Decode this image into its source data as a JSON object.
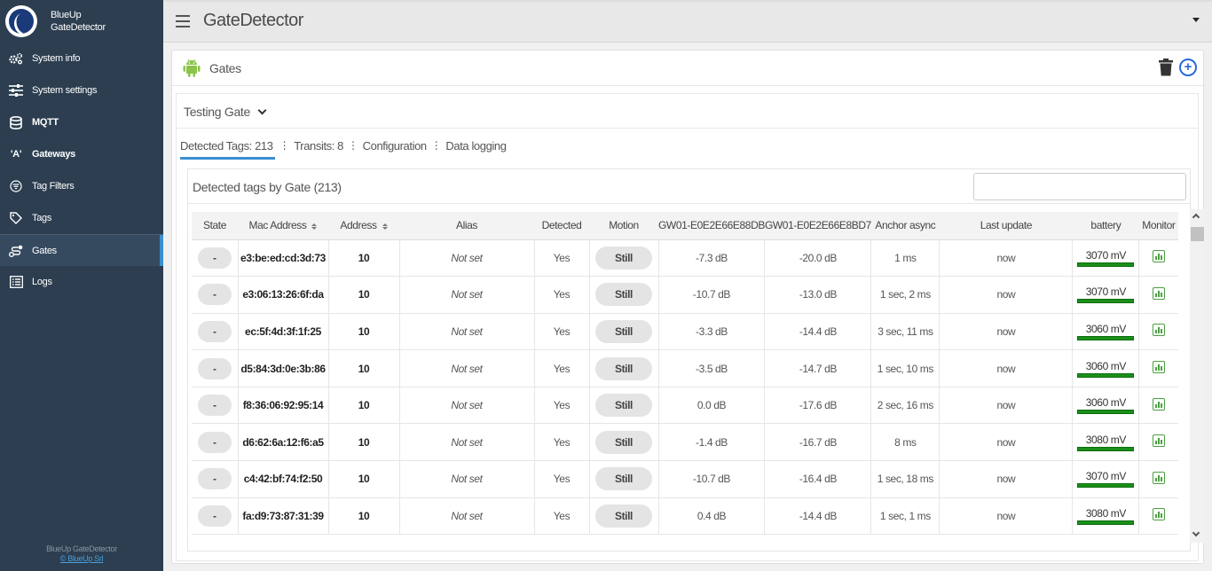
{
  "brand": {
    "line1": "BlueUp",
    "line2": "GateDetector"
  },
  "sidebar": {
    "items": [
      {
        "label": "System info",
        "icon": "cogs-icon"
      },
      {
        "label": "System settings",
        "icon": "sliders-icon"
      },
      {
        "label": "MQTT",
        "icon": "database-icon"
      },
      {
        "label": "Gateways",
        "icon": "antenna-icon"
      },
      {
        "label": "Tag Filters",
        "icon": "filter-icon"
      },
      {
        "label": "Tags",
        "icon": "tag-icon"
      },
      {
        "label": "Gates",
        "icon": "route-icon",
        "active": true
      },
      {
        "label": "Logs",
        "icon": "list-icon"
      }
    ],
    "footer_line1": "BlueUp GateDetector",
    "footer_link": "© BlueUp Srl"
  },
  "header": {
    "title": "GateDetector"
  },
  "card": {
    "title": "Gates"
  },
  "gate_select": {
    "value": "Testing Gate"
  },
  "tabs": [
    {
      "label": "Detected Tags: 213",
      "active": true
    },
    {
      "label": "Transits: 8"
    },
    {
      "label": "Configuration"
    },
    {
      "label": "Data logging"
    }
  ],
  "panel": {
    "title": "Detected tags by Gate (213)",
    "search_placeholder": ""
  },
  "table": {
    "columns": [
      "State",
      "Mac Address",
      "Address",
      "Alias",
      "Detected",
      "Motion",
      "GW01-E0E2E66E88DB",
      "GW01-E0E2E66E8BD7",
      "Anchor async",
      "Last update",
      "battery",
      "Monitor"
    ],
    "rows": [
      {
        "state": "-",
        "mac": "e3:be:ed:cd:3d:73",
        "address": "10",
        "alias": "Not set",
        "detected": "Yes",
        "motion": "Still",
        "gw1": "-7.3 dB",
        "gw2": "-20.0 dB",
        "anchor": "1 ms",
        "last_update": "now",
        "battery": "3070 mV"
      },
      {
        "state": "-",
        "mac": "e3:06:13:26:6f:da",
        "address": "10",
        "alias": "Not set",
        "detected": "Yes",
        "motion": "Still",
        "gw1": "-10.7 dB",
        "gw2": "-13.0 dB",
        "anchor": "1 sec, 2 ms",
        "last_update": "now",
        "battery": "3070 mV"
      },
      {
        "state": "-",
        "mac": "ec:5f:4d:3f:1f:25",
        "address": "10",
        "alias": "Not set",
        "detected": "Yes",
        "motion": "Still",
        "gw1": "-3.3 dB",
        "gw2": "-14.4 dB",
        "anchor": "3 sec, 11 ms",
        "last_update": "now",
        "battery": "3060 mV"
      },
      {
        "state": "-",
        "mac": "d5:84:3d:0e:3b:86",
        "address": "10",
        "alias": "Not set",
        "detected": "Yes",
        "motion": "Still",
        "gw1": "-3.5 dB",
        "gw2": "-14.7 dB",
        "anchor": "1 sec, 10 ms",
        "last_update": "now",
        "battery": "3060 mV"
      },
      {
        "state": "-",
        "mac": "f8:36:06:92:95:14",
        "address": "10",
        "alias": "Not set",
        "detected": "Yes",
        "motion": "Still",
        "gw1": "0.0 dB",
        "gw2": "-17.6 dB",
        "anchor": "2 sec, 16 ms",
        "last_update": "now",
        "battery": "3060 mV"
      },
      {
        "state": "-",
        "mac": "d6:62:6a:12:f6:a5",
        "address": "10",
        "alias": "Not set",
        "detected": "Yes",
        "motion": "Still",
        "gw1": "-1.4 dB",
        "gw2": "-16.7 dB",
        "anchor": "8 ms",
        "last_update": "now",
        "battery": "3080 mV"
      },
      {
        "state": "-",
        "mac": "c4:42:bf:74:f2:50",
        "address": "10",
        "alias": "Not set",
        "detected": "Yes",
        "motion": "Still",
        "gw1": "-10.7 dB",
        "gw2": "-16.4 dB",
        "anchor": "1 sec, 18 ms",
        "last_update": "now",
        "battery": "3070 mV"
      },
      {
        "state": "-",
        "mac": "fa:d9:73:87:31:39",
        "address": "10",
        "alias": "Not set",
        "detected": "Yes",
        "motion": "Still",
        "gw1": "0.4 dB",
        "gw2": "-14.4 dB",
        "anchor": "1 sec, 1 ms",
        "last_update": "now",
        "battery": "3080 mV"
      }
    ]
  },
  "colors": {
    "sidebar_bg": "#2c3e50",
    "accent": "#3a8fd0",
    "battery_bar": "#1a8f1a",
    "monitor_icon": "#4aa03f",
    "add_button": "#2a6ad8"
  }
}
